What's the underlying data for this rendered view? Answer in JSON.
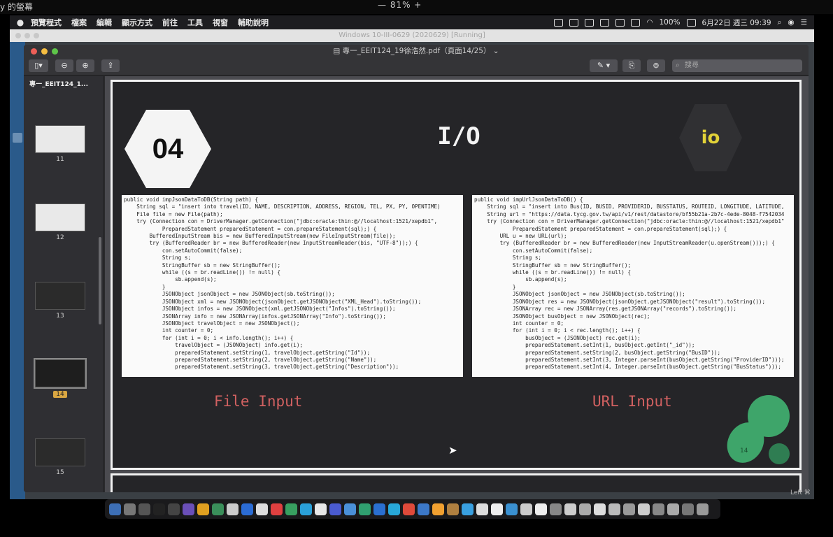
{
  "top_strip": {
    "left": "y 的螢幕",
    "mid": "—   81%   +"
  },
  "menubar": {
    "items": [
      "預覽程式",
      "檔案",
      "編輯",
      "顯示方式",
      "前往",
      "工具",
      "視窗",
      "輔助說明"
    ],
    "battery": "100%",
    "datetime": "6月22日 週三 09:39"
  },
  "vm_title": "Windows 10-III-0629 (2020629) [Running]",
  "preview": {
    "title": "專一_EEIT124_19徐浩然.pdf（頁面14/25）",
    "search_placeholder": "搜尋",
    "sidebar_file": "專一_EEIT124_1...",
    "thumbnails": [
      "11",
      "12",
      "13",
      "14",
      "15"
    ],
    "selected": "14"
  },
  "slide": {
    "number": "04",
    "title": "I/O",
    "badge": "io",
    "caption_left": "File Input",
    "caption_right": "URL Input",
    "page_number": "14",
    "code_left": [
      "public void impJsonDataToDB(String path) {",
      "    String sql = \"insert into travel(ID, NAME, DESCRIPTION, ADDRESS, REGION, TEL, PX, PY, OPENTIME)",
      "    File file = new File(path);",
      "    try (Connection con = DriverManager.getConnection(\"jdbc:oracle:thin:@//localhost:1521/xepdb1\",",
      "            PreparedStatement preparedStatement = con.prepareStatement(sql);) {",
      "        BufferedInputStream bis = new BufferedInputStream(new FileInputStream(file));",
      "        try (BufferedReader br = new BufferedReader(new InputStreamReader(bis, \"UTF-8\"));) {",
      "            con.setAutoCommit(false);",
      "            String s;",
      "            StringBuffer sb = new StringBuffer();",
      "            while ((s = br.readLine()) != null) {",
      "                sb.append(s);",
      "            }",
      "            JSONObject jsonObject = new JSONObject(sb.toString());",
      "            JSONObject xml = new JSONObject(jsonObject.getJSONObject(\"XML_Head\").toString());",
      "            JSONObject infos = new JSONObject(xml.getJSONObject(\"Infos\").toString());",
      "            JSONArray info = new JSONArray(infos.getJSONArray(\"Info\").toString());",
      "            JSONObject travelObject = new JSONObject();",
      "            int counter = 0;",
      "            for (int i = 0; i < info.length(); i++) {",
      "                travelObject = (JSONObject) info.get(i);",
      "                preparedStatement.setString(1, travelObject.getString(\"Id\"));",
      "                preparedStatement.setString(2, travelObject.getString(\"Name\"));",
      "                preparedStatement.setString(3, travelObject.getString(\"Description\"));"
    ],
    "code_right": [
      "public void impUrlJsonDataToDB() {",
      "    String sql = \"insert into Bus(ID, BUSID, PROVIDERID, BUSSTATUS, ROUTEID, LONGITUDE, LATITUDE,",
      "    String url = \"https://data.tycg.gov.tw/api/v1/rest/datastore/bf55b21a-2b7c-4ede-8048-f7542034",
      "    try (Connection con = DriverManager.getConnection(\"jdbc:oracle:thin:@//localhost:1521/xepdb1\"",
      "            PreparedStatement preparedStatement = con.prepareStatement(sql);) {",
      "        URL u = new URL(url);",
      "        try (BufferedReader br = new BufferedReader(new InputStreamReader(u.openStream()));) {",
      "            con.setAutoCommit(false);",
      "            String s;",
      "            StringBuffer sb = new StringBuffer();",
      "            while ((s = br.readLine()) != null) {",
      "                sb.append(s);",
      "            }",
      "            JSONObject jsonObject = new JSONObject(sb.toString());",
      "            JSONObject res = new JSONObject(jsonObject.getJSONObject(\"result\").toString());",
      "            JSONArray rec = new JSONArray(res.getJSONArray(\"records\").toString());",
      "            JSONObject busObject = new JSONObject(rec);",
      "            int counter = 0;",
      "            for (int i = 0; i < rec.length(); i++) {",
      "                busObject = (JSONObject) rec.get(i);",
      "                preparedStatement.setInt(1, busObject.getInt(\"_id\"));",
      "                preparedStatement.setString(2, busObject.getString(\"BusID\"));",
      "                preparedStatement.setInt(3, Integer.parseInt(busObject.getString(\"ProviderID\")));",
      "                preparedStatement.setInt(4, Integer.parseInt(busObject.getString(\"BusStatus\")));"
    ]
  },
  "corner_text": "Left ⌘",
  "colors": {
    "accent_red": "#d26161",
    "accent_green": "#3ea56a",
    "io_yellow": "#e2d238"
  }
}
